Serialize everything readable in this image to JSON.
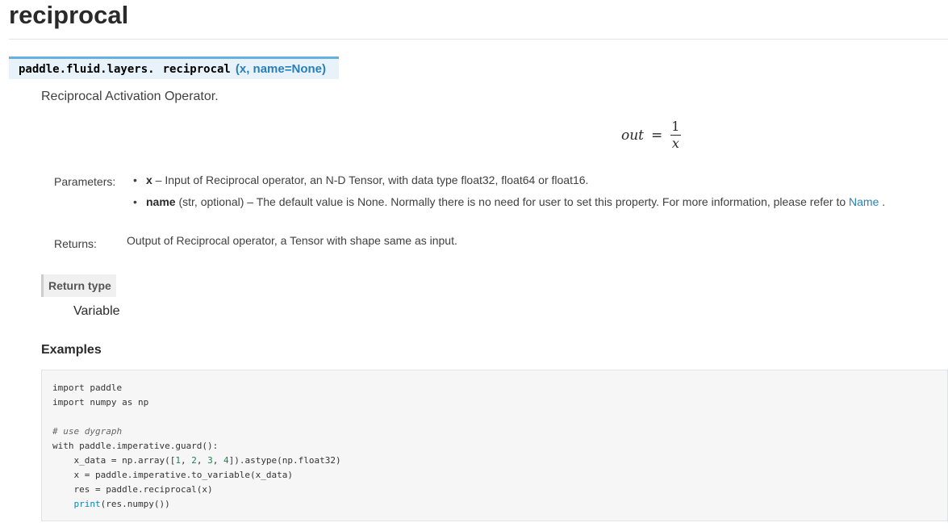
{
  "page": {
    "title": "reciprocal"
  },
  "signature": {
    "module_prefix": "paddle.fluid.layers.",
    "func_name": "reciprocal",
    "params": "(x, name=None)"
  },
  "description": "Reciprocal Activation Operator.",
  "formula": {
    "lhs": "out",
    "equals": "=",
    "numerator": "1",
    "denominator": "x"
  },
  "fields": {
    "parameters_label": "Parameters:",
    "parameters": [
      {
        "bullet": "•",
        "name": "x",
        "sep": " – ",
        "text": "Input of Reciprocal operator, an N-D Tensor, with data type float32, float64 or float16."
      },
      {
        "bullet": "•",
        "name": "name",
        "text": " (str, optional) – The default value is None. Normally there is no need for user to set this property. For more information, please refer to ",
        "link": "Name",
        "tail": " ."
      }
    ],
    "returns_label": "Returns:",
    "returns_text": "Output of Reciprocal operator, a Tensor with shape same as input."
  },
  "return_type": {
    "label": "Return type",
    "value": "Variable"
  },
  "examples": {
    "title": "Examples",
    "code": {
      "l1": "import paddle",
      "l2": "import numpy as np",
      "l4": "# use dygraph",
      "l5": "with paddle.imperative.guard():",
      "l6_a": "    x_data = np.array([",
      "l6_n1": "1",
      "l6_n2": "2",
      "l6_n3": "3",
      "l6_n4": "4",
      "l6_sep": ", ",
      "l6_b": "]).astype(np.float32)",
      "l7": "    x = paddle.imperative.to_variable(x_data)",
      "l8": "    res = paddle.reciprocal(x)",
      "l9_indent": "    ",
      "l9_kw": "print",
      "l9_rest": "(res.numpy())"
    }
  }
}
